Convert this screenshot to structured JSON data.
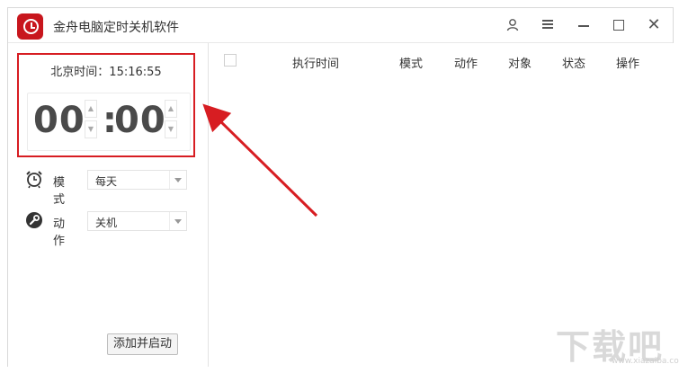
{
  "app": {
    "title": "金舟电脑定时关机软件"
  },
  "titlebar": {
    "user_icon": "user-icon",
    "menu_icon": "menu-icon",
    "minimize_icon": "minimize-icon",
    "maximize_icon": "maximize-icon",
    "close_glyph": "✕"
  },
  "clock": {
    "beijing_time_label": "北京时间：15:16:55",
    "hours": "00",
    "colon": ":",
    "minutes": "00",
    "up_glyph": "▲",
    "down_glyph": "▼"
  },
  "settings": {
    "mode": {
      "label": "模式",
      "value": "每天",
      "icon": "alarm-clock-icon"
    },
    "action": {
      "label": "动作",
      "value": "关机",
      "icon": "wrench-icon"
    }
  },
  "add_button": {
    "label": "添加并启动"
  },
  "table": {
    "columns": [
      "执行时间",
      "模式",
      "动作",
      "对象",
      "状态",
      "操作"
    ]
  },
  "watermark": {
    "text": "下载吧",
    "url": "www.xiazaiba.com"
  },
  "colors": {
    "accent": "#d71d22",
    "app_icon": "#c8161d",
    "arrow": "#d71d22"
  }
}
